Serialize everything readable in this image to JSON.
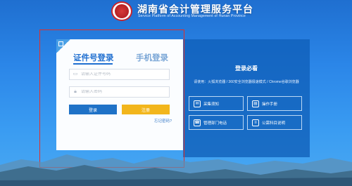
{
  "header": {
    "title": "湖南省会计管理服务平台",
    "subtitle": "Service Platform of Accounting Management of Hunan Province",
    "logo_text": "湘南会计"
  },
  "login": {
    "tabs": [
      {
        "label": "证件号登录",
        "active": true
      },
      {
        "label": "手机登录",
        "active": false
      }
    ],
    "id_placeholder": "请输入证件号码",
    "password_placeholder": "请输入密码",
    "login_button": "登录",
    "register_button": "注册",
    "forgot_link": "忘记密码?"
  },
  "info": {
    "title": "登录必看",
    "note": "请使用：火狐浏览器 / 360安全浏览器极速模式 / Chrome谷歌浏览器",
    "buttons": [
      {
        "label": "采集须知",
        "icon": "notice-icon"
      },
      {
        "label": "操作手册",
        "icon": "manual-icon"
      },
      {
        "label": "管理部门电话",
        "icon": "phone-icon"
      },
      {
        "label": "公需科目说明",
        "icon": "document-icon"
      }
    ]
  },
  "colors": {
    "primary": "#1f72c7",
    "accent": "#f2b61c",
    "highlight_border": "#e0312b"
  }
}
